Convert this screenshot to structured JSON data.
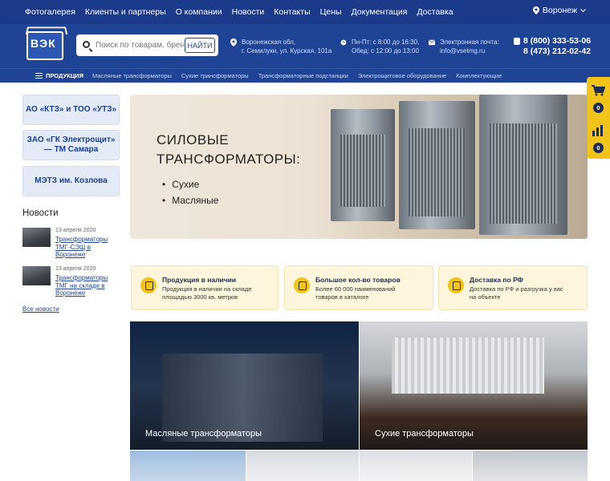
{
  "topnav": [
    "Фотогалерея",
    "Клиенты и партнеры",
    "О компании",
    "Новости",
    "Контакты",
    "Цены",
    "Документация",
    "Доставка"
  ],
  "city": "Воронеж",
  "logo": {
    "text": "ВЭК"
  },
  "search": {
    "placeholder": "Поиск по товарам, брендам...",
    "button": "НАЙТИ"
  },
  "address": {
    "line1": "Воронежская обл,",
    "line2": "г. Семилуки, ул. Курская, 101а"
  },
  "hours": {
    "line1": "Пн-Пт: с 8:00 до 16:30,",
    "line2": "Обед: с 12:00 до 13:00"
  },
  "email": {
    "label": "Электронная почта:",
    "value": "info@vsetmg.ru"
  },
  "phones": [
    "8 (800) 333-53-06",
    "8 (473) 212-02-42"
  ],
  "catbar": {
    "products": "ПРОДУКЦИЯ",
    "items": [
      "Масляные трансформаторы",
      "Сухие трансформаторы",
      "Трансформаторные подстанции",
      "Электрощитовое оборудование",
      "Комплектующие"
    ]
  },
  "side_counts": {
    "cart": "0",
    "compare": "0"
  },
  "left_buttons": [
    "АО «КТЗ» и ТОО «УТЗ»",
    "ЗАО «ГК Электрощит» — ТМ Самара",
    "МЭТЗ им. Козлова"
  ],
  "news": {
    "title": "Новости",
    "items": [
      {
        "date": "13 апреля 2020",
        "title": "Трансформаторы ТМГ-СЭЩ в Воронеже"
      },
      {
        "date": "13 апреля 2020",
        "title": "Трансформаторы ТМГ на складе в Воронеже"
      }
    ],
    "all": "Все новости"
  },
  "hero": {
    "title1": "СИЛОВЫЕ",
    "title2": "ТРАНСФОРМАТОРЫ:",
    "items": [
      "Сухие",
      "Масляные"
    ]
  },
  "advantages": [
    {
      "title": "Продукция в наличии",
      "desc": "Продукция в наличии на складе площадью 3000 кв. метров"
    },
    {
      "title": "Большое кол-во товаров",
      "desc": "Более 60 000 наименований товаров в каталоге"
    },
    {
      "title": "Доставка по РФ",
      "desc": "Доставка по РФ и разгрузка у вас на объекте"
    }
  ],
  "tiles": [
    "Масляные трансформаторы",
    "Сухие трансформаторы"
  ]
}
